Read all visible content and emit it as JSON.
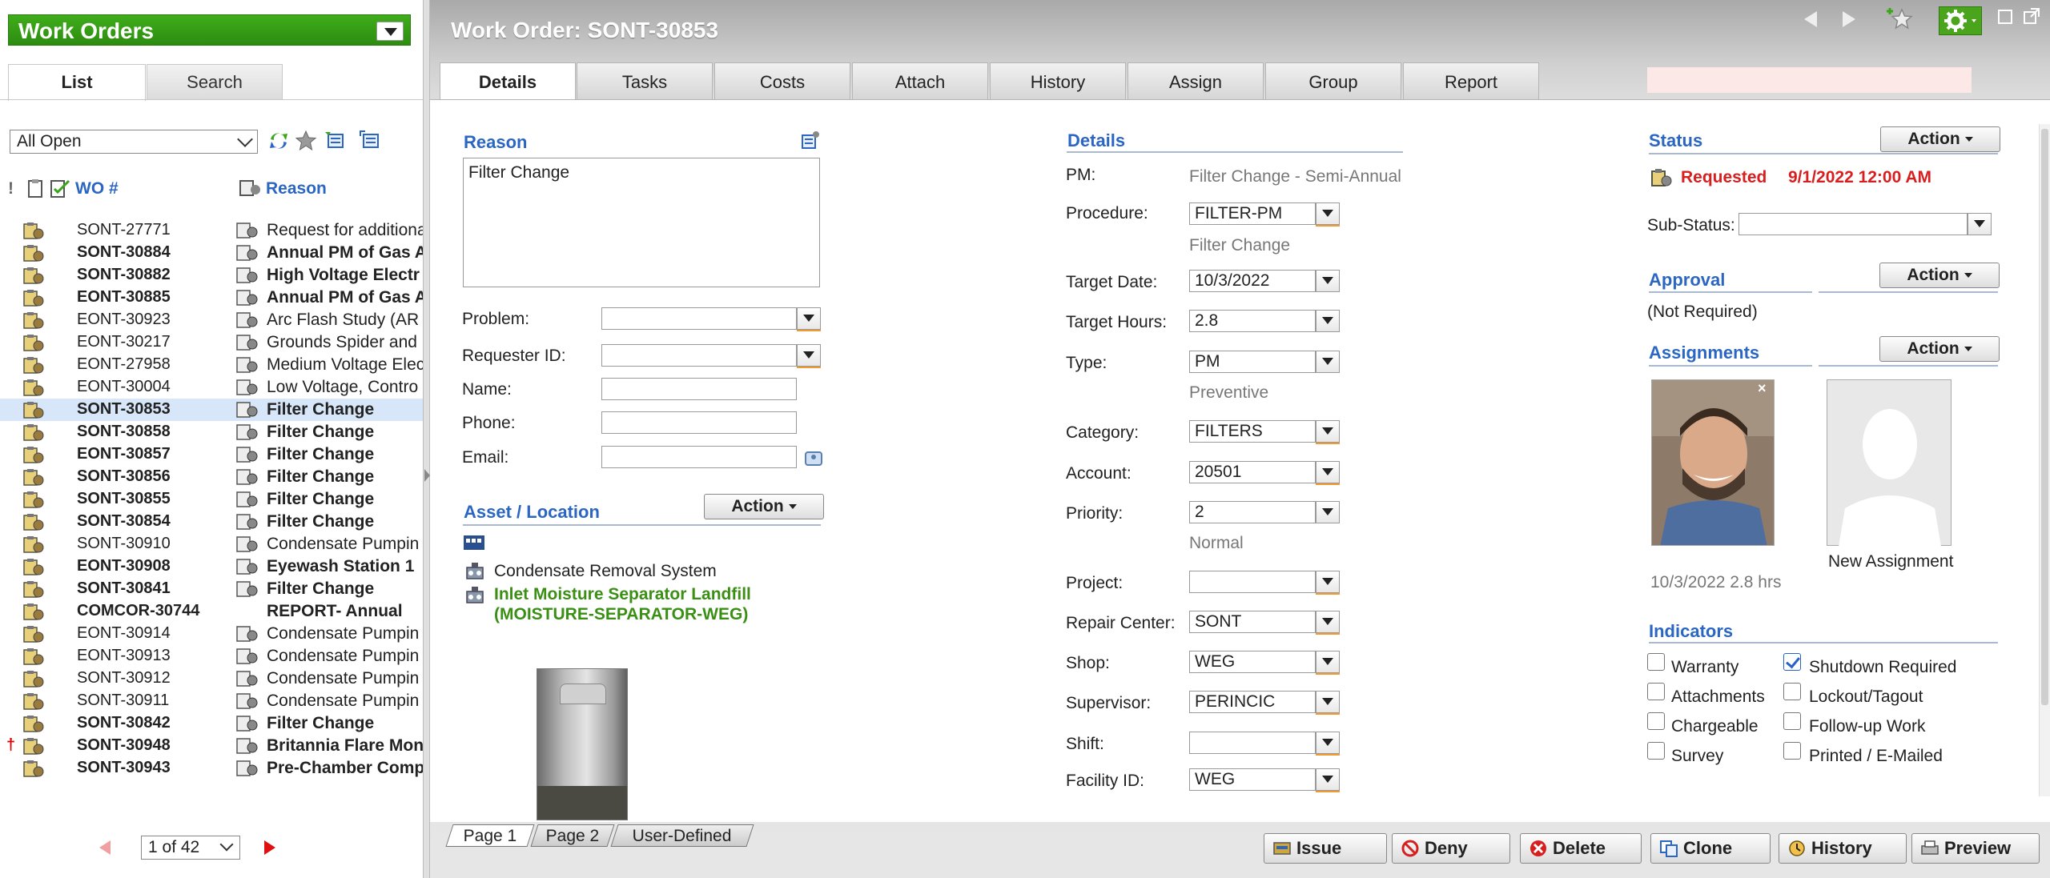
{
  "left_panel": {
    "title": "Work Orders",
    "tabs": [
      "List",
      "Search"
    ],
    "filter": "All Open",
    "columns": {
      "wo": "WO #",
      "reason": "Reason"
    },
    "rows": [
      {
        "wo": "SONT-27771",
        "reason": "Request for additional",
        "bold": false
      },
      {
        "wo": "SONT-30884",
        "reason": "Annual PM of Gas A",
        "bold": true
      },
      {
        "wo": "SONT-30882",
        "reason": "High Voltage Electr",
        "bold": true
      },
      {
        "wo": "EONT-30885",
        "reason": "Annual PM of Gas A",
        "bold": true
      },
      {
        "wo": "EONT-30923",
        "reason": "Arc Flash Study (AR",
        "bold": false
      },
      {
        "wo": "EONT-30217",
        "reason": "Grounds Spider and",
        "bold": false
      },
      {
        "wo": "EONT-27958",
        "reason": "Medium Voltage Elec",
        "bold": false
      },
      {
        "wo": "EONT-30004",
        "reason": "Low Voltage, Contro",
        "bold": false
      },
      {
        "wo": "SONT-30853",
        "reason": "Filter Change",
        "bold": true,
        "selected": true
      },
      {
        "wo": "SONT-30858",
        "reason": "Filter Change",
        "bold": true
      },
      {
        "wo": "EONT-30857",
        "reason": "Filter Change",
        "bold": true
      },
      {
        "wo": "SONT-30856",
        "reason": "Filter Change",
        "bold": true
      },
      {
        "wo": "SONT-30855",
        "reason": "Filter Change",
        "bold": true
      },
      {
        "wo": "SONT-30854",
        "reason": "Filter Change",
        "bold": true
      },
      {
        "wo": "SONT-30910",
        "reason": "Condensate Pumpin",
        "bold": false
      },
      {
        "wo": "EONT-30908",
        "reason": "Eyewash Station 1",
        "bold": true
      },
      {
        "wo": "SONT-30841",
        "reason": "Filter Change",
        "bold": true
      },
      {
        "wo": "COMCOR-30744",
        "reason": "REPORT- Annual",
        "bold": true,
        "no_icon": true
      },
      {
        "wo": "EONT-30914",
        "reason": "Condensate Pumpin",
        "bold": false
      },
      {
        "wo": "EONT-30913",
        "reason": "Condensate Pumpin",
        "bold": false
      },
      {
        "wo": "SONT-30912",
        "reason": "Condensate Pumpin",
        "bold": false
      },
      {
        "wo": "SONT-30911",
        "reason": "Condensate Pumpin",
        "bold": false
      },
      {
        "wo": "SONT-30842",
        "reason": "Filter Change",
        "bold": true
      },
      {
        "wo": "SONT-30948",
        "reason": "Britannia Flare Mon",
        "bold": true,
        "priority": "†"
      },
      {
        "wo": "SONT-30943",
        "reason": "Pre-Chamber Comp",
        "bold": true
      }
    ],
    "pager": "1 of 42"
  },
  "header": {
    "title": "Work Order: SONT-30853",
    "tabs": [
      "Details",
      "Tasks",
      "Costs",
      "Attach",
      "History",
      "Assign",
      "Group",
      "Report"
    ]
  },
  "reason": {
    "title": "Reason",
    "text": "Filter Change"
  },
  "form_left": {
    "problem": {
      "label": "Problem:",
      "value": ""
    },
    "requester": {
      "label": "Requester ID:",
      "value": ""
    },
    "name": {
      "label": "Name:",
      "value": ""
    },
    "phone": {
      "label": "Phone:",
      "value": ""
    },
    "email": {
      "label": "Email:",
      "value": ""
    }
  },
  "asset": {
    "title": "Asset / Location",
    "action": "Action",
    "items": [
      "Condensate Removal System",
      "Inlet Moisture Separator Landfill (MOISTURE-SEPARATOR-WEG)"
    ]
  },
  "details": {
    "title": "Details",
    "pm": {
      "label": "PM:",
      "value": "Filter Change - Semi-Annual"
    },
    "procedure": {
      "label": "Procedure:",
      "value": "FILTER-PM",
      "sub": "Filter Change"
    },
    "target_date": {
      "label": "Target Date:",
      "value": "10/3/2022"
    },
    "target_hours": {
      "label": "Target Hours:",
      "value": "2.8"
    },
    "type": {
      "label": "Type:",
      "value": "PM",
      "sub": "Preventive"
    },
    "category": {
      "label": "Category:",
      "value": "FILTERS"
    },
    "account": {
      "label": "Account:",
      "value": "20501"
    },
    "priority": {
      "label": "Priority:",
      "value": "2",
      "sub": "Normal"
    },
    "project": {
      "label": "Project:",
      "value": ""
    },
    "repair_center": {
      "label": "Repair Center:",
      "value": "SONT"
    },
    "shop": {
      "label": "Shop:",
      "value": "WEG"
    },
    "supervisor": {
      "label": "Supervisor:",
      "value": "PERINCIC"
    },
    "shift": {
      "label": "Shift:",
      "value": ""
    },
    "facility": {
      "label": "Facility ID:",
      "value": "WEG"
    }
  },
  "status": {
    "title": "Status",
    "action": "Action",
    "state": "Requested",
    "date": "9/1/2022 12:00 AM",
    "substatus_label": "Sub-Status:",
    "substatus_value": ""
  },
  "approval": {
    "title": "Approval",
    "action": "Action",
    "value": "(Not Required)"
  },
  "assignments": {
    "title": "Assignments",
    "action": "Action",
    "info": "10/3/2022 2.8 hrs",
    "new_label": "New Assignment"
  },
  "indicators": {
    "title": "Indicators",
    "items": [
      {
        "label": "Warranty",
        "checked": false
      },
      {
        "label": "Shutdown Required",
        "checked": true
      },
      {
        "label": "Attachments",
        "checked": false
      },
      {
        "label": "Lockout/Tagout",
        "checked": false
      },
      {
        "label": "Chargeable",
        "checked": false
      },
      {
        "label": "Follow-up Work",
        "checked": false
      },
      {
        "label": "Survey",
        "checked": false
      },
      {
        "label": "Printed / E-Mailed",
        "checked": false
      }
    ]
  },
  "page_tabs": [
    "Page 1",
    "Page 2",
    "User-Defined"
  ],
  "bottom_buttons": [
    "Issue",
    "Deny",
    "Delete",
    "Clone",
    "History",
    "Preview"
  ],
  "colors": {
    "accent_green": "#3fad1b",
    "link_blue": "#2a66c2",
    "status_red": "#d62020"
  }
}
